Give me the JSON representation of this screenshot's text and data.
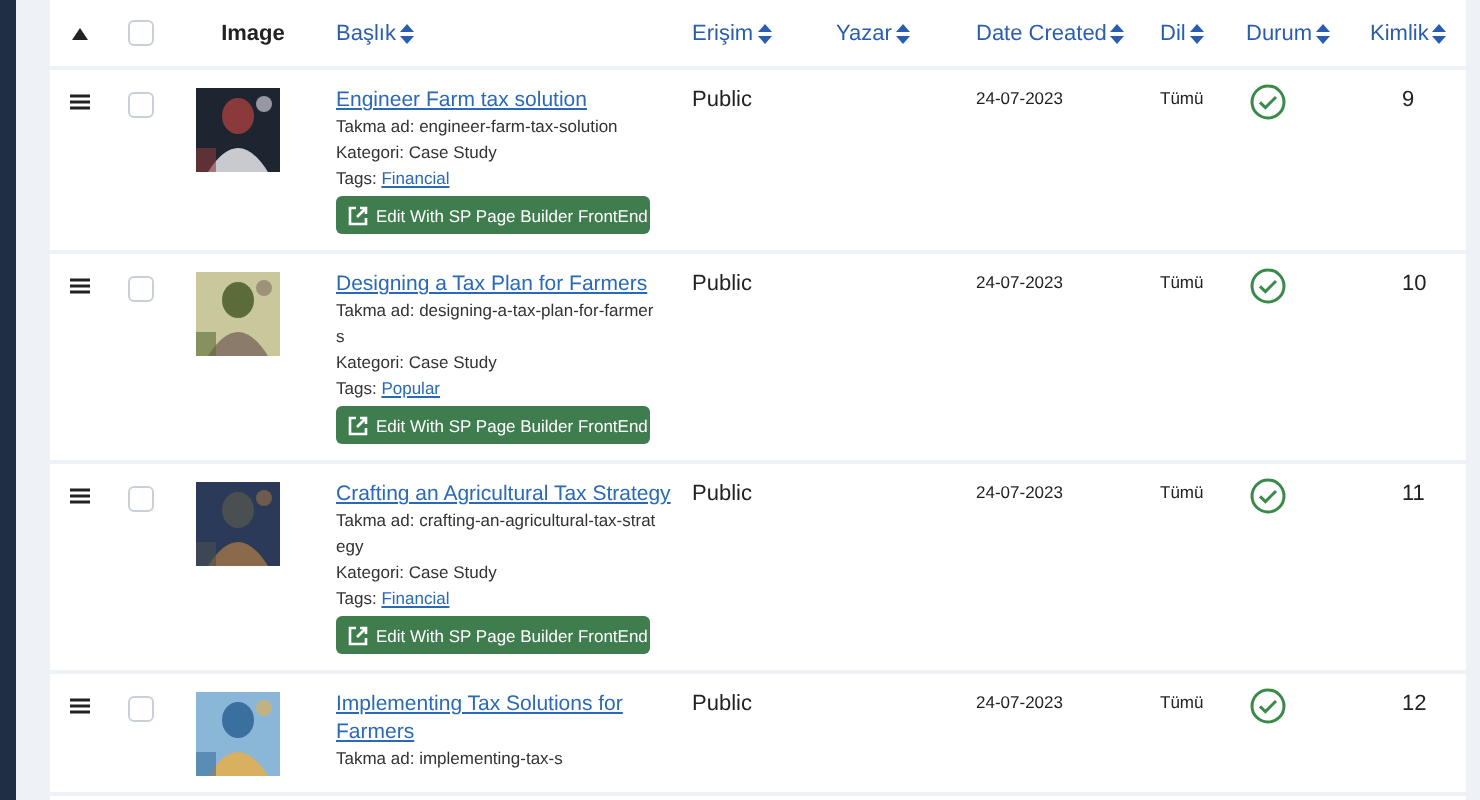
{
  "table": {
    "select_all": {
      "checked": false
    },
    "columns": [
      {
        "label": "Image",
        "sortable": false
      },
      {
        "label": "Başlık",
        "sortable": true
      },
      {
        "label": "Erişim",
        "sortable": true
      },
      {
        "label": "Yazar",
        "sortable": true
      },
      {
        "label": "Date Created",
        "sortable": true
      },
      {
        "label": "Dil",
        "sortable": true
      },
      {
        "label": "Durum",
        "sortable": true
      },
      {
        "label": "Kimlik",
        "sortable": true
      }
    ],
    "rows": [
      {
        "checked": false,
        "title": "Engineer Farm tax solution",
        "alias": "Takma ad: engineer-farm-tax-solution",
        "category": "Kategori: Case Study",
        "tags_label": "Tags:",
        "tag": "Financial",
        "button": "Edit With SP Page Builder FrontEnd",
        "access": "Public",
        "date": "24-07-2023",
        "language": "Tümü",
        "published": true,
        "id": "9"
      },
      {
        "checked": false,
        "title": "Designing a Tax Plan for Farmers",
        "alias": "Takma ad: designing-a-tax-plan-for-farmers",
        "category": "Kategori: Case Study",
        "tags_label": "Tags:",
        "tag": "Popular",
        "button": "Edit With SP Page Builder FrontEnd",
        "access": "Public",
        "date": "24-07-2023",
        "language": "Tümü",
        "published": true,
        "id": "10"
      },
      {
        "checked": false,
        "title": "Crafting an Agricultural Tax Strategy",
        "alias": "Takma ad: crafting-an-agricultural-tax-strategy",
        "category": "Kategori: Case Study",
        "tags_label": "Tags:",
        "tag": "Financial",
        "button": "Edit With SP Page Builder FrontEnd",
        "access": "Public",
        "date": "24-07-2023",
        "language": "Tümü",
        "published": true,
        "id": "11"
      },
      {
        "checked": false,
        "title": "Implementing Tax Solutions for Farmers",
        "alias": "Takma ad: implementing-tax-s",
        "access": "Public",
        "date": "24-07-2023",
        "language": "Tümü",
        "published": true,
        "id": "12"
      }
    ]
  }
}
